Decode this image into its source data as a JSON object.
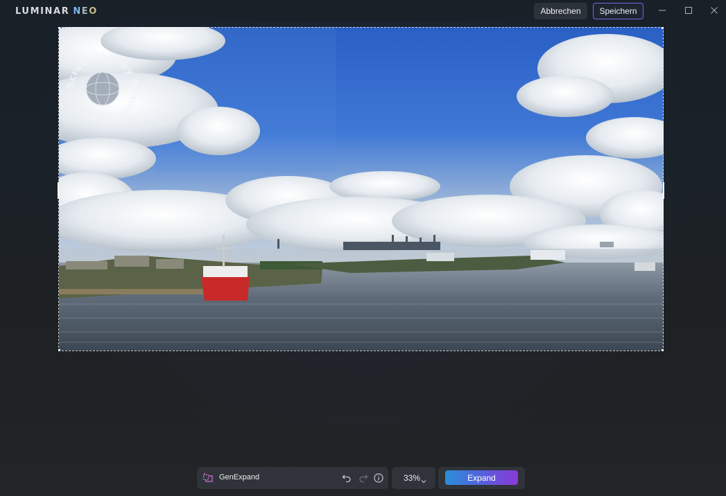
{
  "app": {
    "logo_main": "LUMINAR",
    "logo_accent": "NEO"
  },
  "header": {
    "cancel_label": "Abbrechen",
    "save_label": "Speichern"
  },
  "toolbar": {
    "tool_name": "GenExpand",
    "zoom": "33%",
    "expand_label": "Expand"
  },
  "watermark": {
    "text": "Screenshot by Alladesign.eu"
  },
  "colors": {
    "accent_border": "#7b68e8",
    "expand_gradient_start": "#2a8fd8",
    "expand_gradient_end": "#8a3ad8"
  }
}
